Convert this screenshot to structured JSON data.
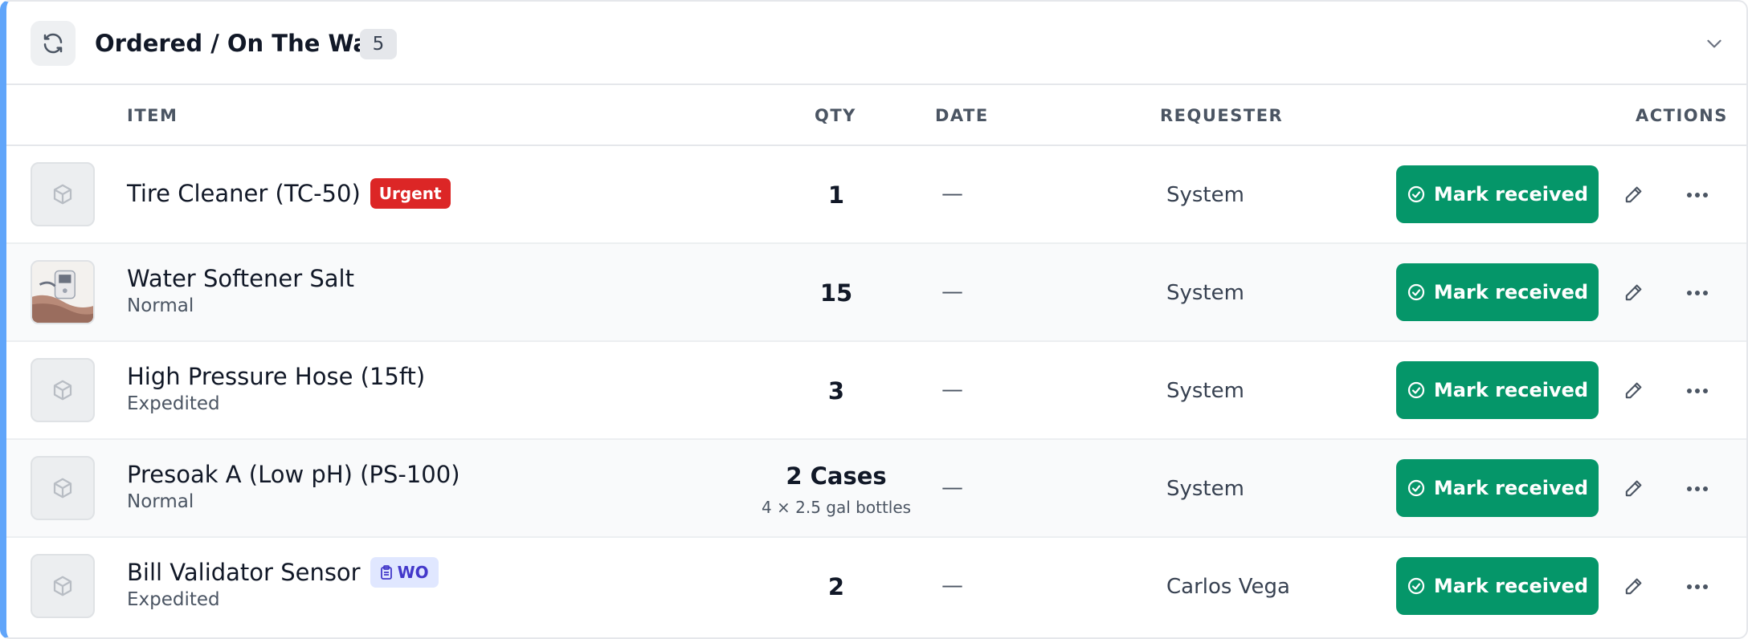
{
  "section": {
    "title": "Ordered / On The Way",
    "count": "5",
    "icons": {
      "refresh": "refresh-icon",
      "toggle": "chevron-down-icon"
    },
    "accent_color": "#60a5fa"
  },
  "columns": {
    "item": "ITEM",
    "qty": "QTY",
    "date": "DATE",
    "requester": "REQUESTER",
    "actions": "ACTIONS"
  },
  "rows": [
    {
      "name": "Tire Cleaner (TC-50)",
      "badge": "Urgent",
      "priority": "",
      "qty": "1",
      "qty_detail": "",
      "date": "—",
      "requester": "System",
      "thumbnail": "box-icon"
    },
    {
      "name": "Water Softener Salt",
      "badge": "",
      "priority": "Normal",
      "qty": "15",
      "qty_detail": "",
      "date": "—",
      "requester": "System",
      "thumbnail": "product-photo"
    },
    {
      "name": "High Pressure Hose (15ft)",
      "badge": "",
      "priority": "Expedited",
      "qty": "3",
      "qty_detail": "",
      "date": "—",
      "requester": "System",
      "thumbnail": "box-icon"
    },
    {
      "name": "Presoak A (Low pH) (PS-100)",
      "badge": "",
      "priority": "Normal",
      "qty": "2 Cases",
      "qty_detail": "4 × 2.5 gal bottles",
      "date": "—",
      "requester": "System",
      "thumbnail": "box-icon"
    },
    {
      "name": "Bill Validator Sensor",
      "badge": "WO",
      "priority": "Expedited",
      "qty": "2",
      "qty_detail": "",
      "date": "—",
      "requester": "Carlos Vega",
      "thumbnail": "box-icon"
    }
  ],
  "actions": {
    "mark_received": "Mark received",
    "button_color": "#059669",
    "urgent_color": "#dc2626"
  }
}
